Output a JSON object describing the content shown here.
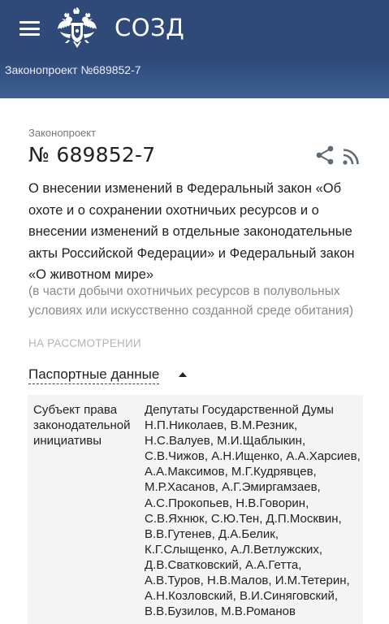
{
  "header": {
    "app_title": "СОЗД",
    "menu_icon": "hamburger-menu-icon",
    "emblem_icon": "russian-coat-of-arms-emblem",
    "bg_color": "#2f4a78"
  },
  "breadcrumb": {
    "label": "Законопроект №689852-7"
  },
  "bill": {
    "type_label": "Законопроект",
    "number": "№ 689852-7",
    "share_icon": "share-icon",
    "rss_icon": "rss-icon",
    "title": "О внесении изменений в Федеральный закон «Об охоте и о сохранении охотничьих ресурсов и о внесении изменений в отдельные законодательные акты Российской Федерации» и Федеральный закон «О животном мире»",
    "note": "(в части добычи охотничьих ресурсов в полувольных условиях или искусственно созданной среде обитания)",
    "status": "НА РАССМОТРЕНИИ"
  },
  "passport": {
    "toggle_label": "Паспортные данные",
    "rows": [
      {
        "label": "Субъект права законодательной инициативы",
        "value_lines": [
          "Депутаты Государственной Думы",
          "Н.П.Николаев, В.М.Резник,",
          "Н.С.Валуев, М.И.Щаблыкин,",
          "С.В.Чижов, А.Н.Ищенко, А.А.Харсиев,",
          "А.А.Максимов, М.Г.Кудрявцев,",
          "М.Р.Хасанов, А.Г.Эмиргамзаев,",
          "А.С.Прокопьев, Н.В.Говорин,",
          "С.В.Яхнюк, С.Ю.Тен, Д.П.Москвин,",
          "В.В.Гутенев, Д.А.Белик,",
          "К.Г.Слыщенко, А.Л.Ветлужских,",
          "Д.В.Сватковский, А.А.Гетта,",
          "А.В.Туров, Н.В.Малов, И.М.Тетерин,",
          "А.Н.Козловский, В.И.Синяговский,",
          "В.В.Бузилов, М.В.Романов"
        ]
      }
    ]
  }
}
